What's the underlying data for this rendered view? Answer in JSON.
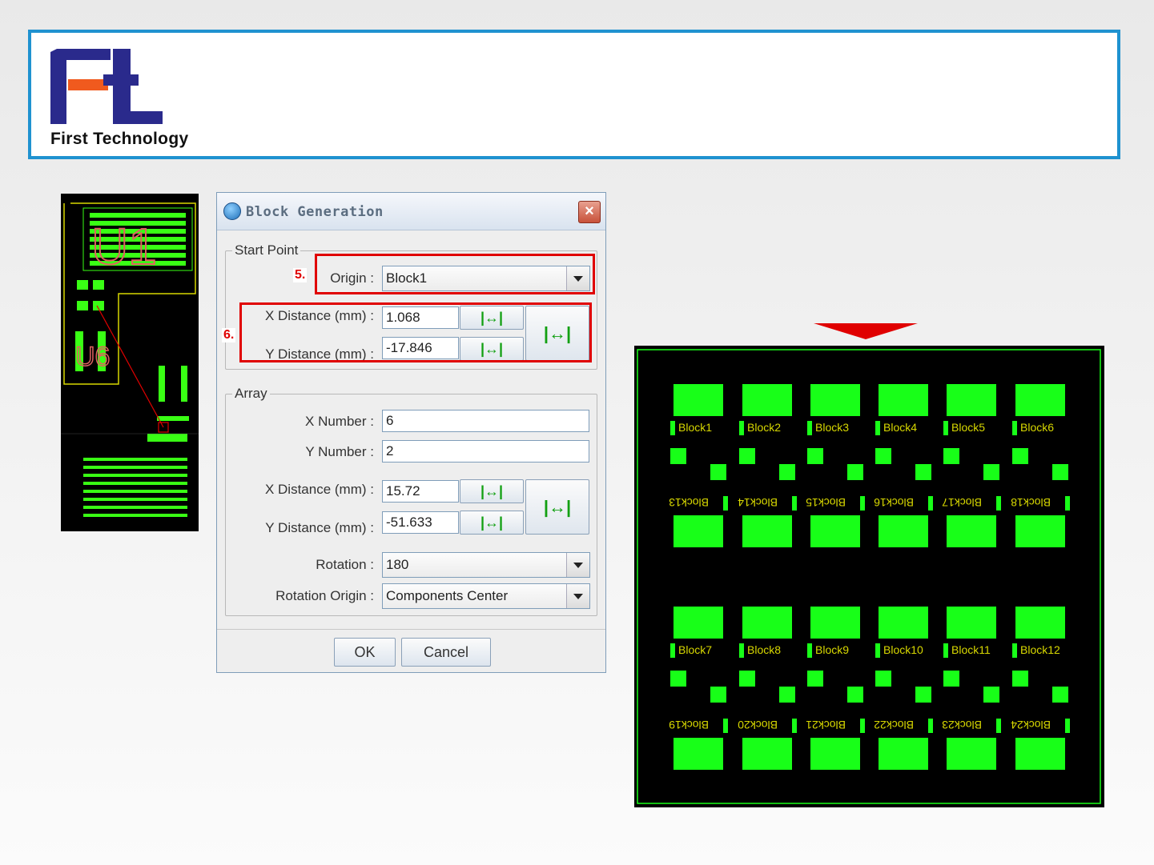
{
  "company": {
    "name": "First Technology",
    "brand_blue": "#2a2a8c",
    "brand_orange": "#f05a1e"
  },
  "header_border_color": "#1f92d0",
  "pcb_preview": {
    "labels": [
      "U1",
      "U6"
    ],
    "trace_color": "#39ff14",
    "outline_color": "#d8d800",
    "label_color": "#e06060"
  },
  "dialog": {
    "title": "Block Generation",
    "close_icon": "close-x-icon",
    "start_point": {
      "legend": "Start Point",
      "origin_label": "Origin :",
      "origin_value": "Block1",
      "x_distance_label": "X Distance (mm) :",
      "x_distance_value": "1.068",
      "y_distance_label": "Y Distance (mm) :",
      "y_distance_value": "-17.846",
      "pick_icon": "measure-distance-icon"
    },
    "array": {
      "legend": "Array",
      "x_number_label": "X Number :",
      "x_number_value": "6",
      "y_number_label": "Y Number :",
      "y_number_value": "2",
      "x_distance_label": "X Distance (mm) :",
      "x_distance_value": "15.72",
      "y_distance_label": "Y Distance (mm) :",
      "y_distance_value": "-51.633",
      "rotation_label": "Rotation :",
      "rotation_value": "180",
      "rotation_origin_label": "Rotation Origin :",
      "rotation_origin_value": "Components Center"
    },
    "ok_label": "OK",
    "cancel_label": "Cancel"
  },
  "annotations": {
    "step5": "5.",
    "step6": "6.",
    "highlight_color": "#e00000"
  },
  "result_panel": {
    "block_color": "#18ff18",
    "label_color": "#d8d800",
    "top_row1": [
      "Block1",
      "Block2",
      "Block3",
      "Block4",
      "Block5",
      "Block6"
    ],
    "top_row2": [
      "Block13",
      "Block14",
      "Block15",
      "Block16",
      "Block17",
      "Block18"
    ],
    "bottom_row1": [
      "Block7",
      "Block8",
      "Block9",
      "Block10",
      "Block11",
      "Block12"
    ],
    "bottom_row2": [
      "Block19",
      "Block20",
      "Block21",
      "Block22",
      "Block23",
      "Block24"
    ]
  }
}
